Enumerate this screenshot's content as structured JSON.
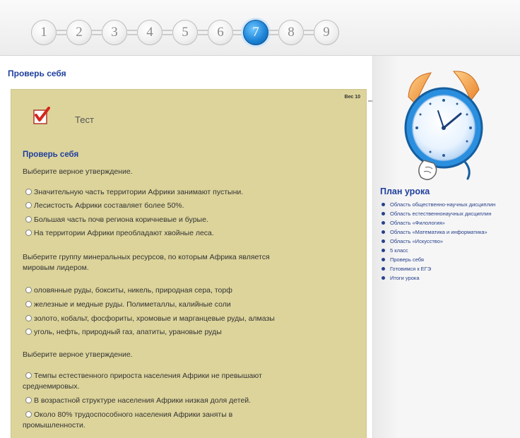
{
  "nav": {
    "steps": [
      "1",
      "2",
      "3",
      "4",
      "5",
      "6",
      "7",
      "8",
      "9"
    ],
    "active_index": 6
  },
  "content": {
    "section_heading": "Проверь себя",
    "weight_label": "Вес 10",
    "test_title": "Тест",
    "check_heading": "Проверь себя",
    "q1": {
      "prompt": "Выберите верное утверждение.",
      "options": [
        "Значительную часть территории Африки занимают пустыни.",
        "Лесистость Африки составляет более 50%.",
        "Большая часть почв региона коричневые и бурые.",
        "На территории Африки преобладают хвойные леса."
      ]
    },
    "q2": {
      "prompt_line1": "Выберите группу минеральных ресурсов, по которым Африка является",
      "prompt_line2": "мировым лидером.",
      "options": [
        "оловянные руды, бокситы, никель, природная сера, торф",
        "железные и медные руды. Полиметаллы, калийные соли",
        "золото, кобальт, фосфориты, хромовые и марганцевые руды, алмазы",
        "уголь, нефть, природный газ, апатиты, урановые руды"
      ]
    },
    "q3": {
      "prompt": "Выберите верное утверждение.",
      "options": [
        [
          "Темпы естественного прироста населения Африки не превышают",
          "среднемировых."
        ],
        [
          "В возрастной структуре населения Африки низкая доля детей."
        ],
        [
          "Около 80% трудоспособного населения Африки заняты в",
          "промышленности."
        ]
      ]
    }
  },
  "sidebar": {
    "plan_title": "План урока",
    "items": [
      "Область общественно-научных дисциплин",
      "Область естественнонаучных дисциплин",
      "Область «Филология»",
      "Область «Математика и информатика»",
      "Область «Искусство»",
      "5 класс",
      "Проверь себя",
      "Готовимся к ЕГЭ",
      "Итоги урока"
    ]
  },
  "colors": {
    "accent_blue": "#1f86d8",
    "heading_blue": "#1f3f9e",
    "test_panel": "#ddd49b"
  }
}
